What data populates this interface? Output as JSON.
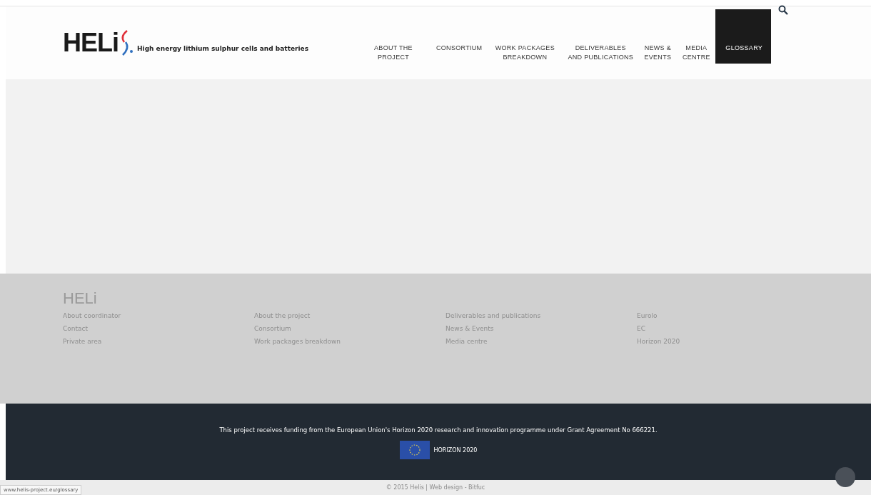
{
  "header": {
    "logo": "HELi",
    "tagline": "High energy lithium sulphur cells and batteries",
    "nav": [
      {
        "label": "ABOUT THE PROJECT",
        "selected": false
      },
      {
        "label": "CONSORTIUM",
        "selected": false
      },
      {
        "label": "WORK PACKAGES BREAKDOWN",
        "selected": false
      },
      {
        "label": "DELIVERABLES AND PUBLICATIONS",
        "selected": false
      },
      {
        "label": "NEWS & EVENTS",
        "selected": false
      },
      {
        "label": "MEDIA CENTRE",
        "selected": false
      },
      {
        "label": "GLOSSARY",
        "selected": true
      }
    ]
  },
  "footer": {
    "logo": "HELi",
    "columns": [
      [
        "About coordinator",
        "Contact",
        "Private area"
      ],
      [
        "About the project",
        "Consortium",
        "Work packages breakdown"
      ],
      [
        "Deliverables and publications",
        "News & Events",
        "Media centre"
      ],
      [
        "Eurolo",
        "EC",
        "Horizon 2020"
      ]
    ]
  },
  "funding": {
    "text": "This project receives funding from the European Union's Horizon 2020 research and innovation programme under Grant Agreement No 666221.",
    "programme": "HORIZON 2020"
  },
  "copyright": "© 2015 Helis | Web design - Bitfuc",
  "status_url": "www.helis-project.eu/glossary"
}
